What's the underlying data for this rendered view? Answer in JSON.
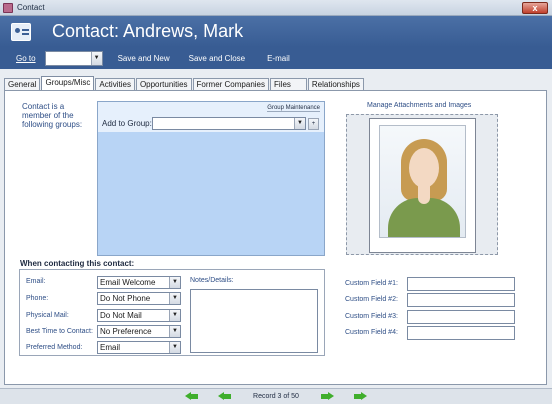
{
  "window": {
    "title": "Contact",
    "close_glyph": "x"
  },
  "header": {
    "title": "Contact: Andrews, Mark",
    "icon": "contact-card-icon"
  },
  "toolbar": {
    "goto_label": "Go to",
    "goto_value": "",
    "save_new": "Save and New",
    "save_close": "Save and Close",
    "email": "E-mail"
  },
  "tabs": [
    "General",
    "Groups/Misc",
    "Activities",
    "Opportunities",
    "Former Companies",
    "Files",
    "Relationships"
  ],
  "active_tab": "Groups/Misc",
  "groups": {
    "label": "Contact is a member of the following groups:",
    "maintenance": "Group Maintenance",
    "add_label": "Add to Group:",
    "add_value": "",
    "add_button": "+"
  },
  "contacting": {
    "heading": "When contacting this contact:",
    "fields": [
      {
        "label": "Email:",
        "value": "Email Welcome"
      },
      {
        "label": "Phone:",
        "value": "Do Not Phone"
      },
      {
        "label": "Physical Mail:",
        "value": "Do Not Mail"
      },
      {
        "label": "Best Time to Contact:",
        "value": "No Preference"
      },
      {
        "label": "Preferred Method:",
        "value": "Email"
      }
    ],
    "notes_label": "Notes/Details:",
    "notes_value": ""
  },
  "attachments": {
    "label": "Manage Attachments and Images"
  },
  "custom_fields": [
    {
      "label": "Custom Field #1:",
      "value": ""
    },
    {
      "label": "Custom Field #2:",
      "value": ""
    },
    {
      "label": "Custom Field #3:",
      "value": ""
    },
    {
      "label": "Custom Field #4:",
      "value": ""
    }
  ],
  "record_nav": {
    "text": "Record 3 of 50"
  },
  "colors": {
    "header": "#385c93",
    "label_blue": "#2e4e86",
    "groups_panel": "#b8d4f5",
    "nav_green": "#3fae2c"
  }
}
